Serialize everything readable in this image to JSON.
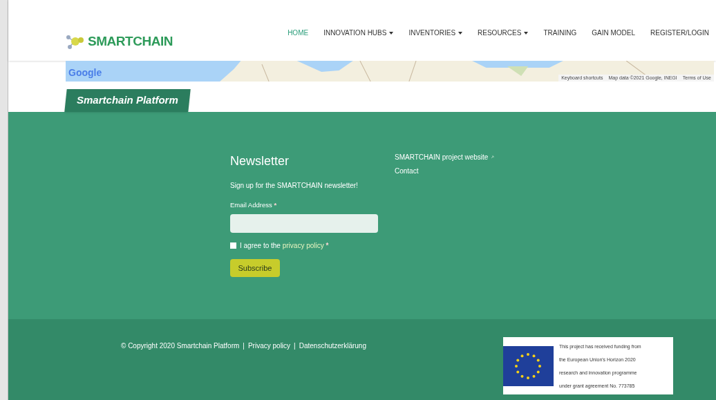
{
  "logo": {
    "text": "SMARTCHAIN"
  },
  "nav": [
    {
      "label": "HOME",
      "selected": true,
      "dropdown": false
    },
    {
      "label": "INNOVATION HUBS",
      "selected": false,
      "dropdown": true
    },
    {
      "label": "INVENTORIES",
      "selected": false,
      "dropdown": true
    },
    {
      "label": "RESOURCES",
      "selected": false,
      "dropdown": true
    },
    {
      "label": "TRAINING",
      "selected": false,
      "dropdown": false
    },
    {
      "label": "GAIN MODEL",
      "selected": false,
      "dropdown": false
    },
    {
      "label": "REGISTER/LOGIN",
      "selected": false,
      "dropdown": false
    }
  ],
  "map": {
    "logo": "Google",
    "attribution": [
      "Keyboard shortcuts",
      "Map data ©2021 Google, INEGI",
      "Terms of Use"
    ]
  },
  "section_tab": "Smartchain Platform",
  "newsletter": {
    "title": "Newsletter",
    "intro": "Sign up for the SMARTCHAIN newsletter!",
    "email_label": "Email Address",
    "required_mark": "*",
    "agree_text": "I agree to the",
    "agree_link": "privacy policy",
    "agree_required": "*",
    "agree_checked": false,
    "button": "Subscribe"
  },
  "links": [
    {
      "label": "SMARTCHAIN project website",
      "external": true
    },
    {
      "label": "Contact",
      "external": false
    }
  ],
  "footer": {
    "copyright": "© Copyright 2020 Smartchain Platform",
    "links": [
      "Privacy policy",
      "Datenschutzerklärung"
    ],
    "separator": "|"
  },
  "funding": {
    "lines": [
      "This project has received funding from",
      "the European Union's Horizon 2020",
      "research and innovation programme",
      "under grant agreement  No. 773785"
    ]
  }
}
